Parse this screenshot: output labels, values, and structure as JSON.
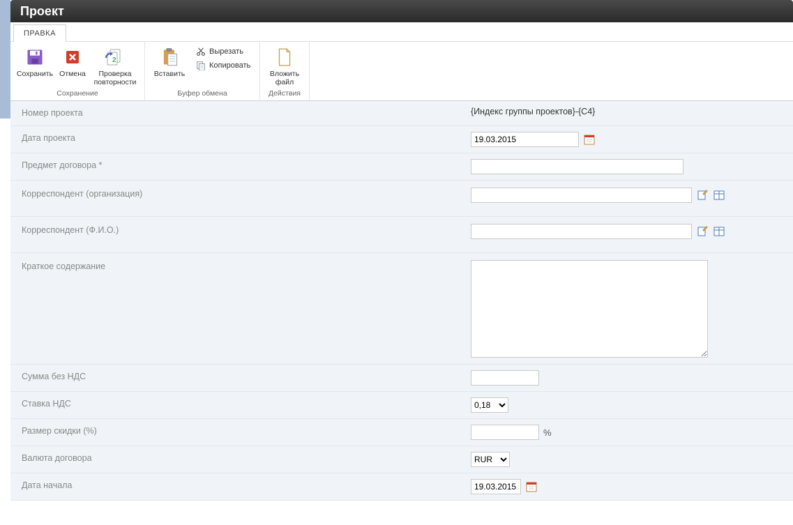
{
  "window": {
    "title": "Проект"
  },
  "tabs": {
    "edit": "ПРАВКА"
  },
  "ribbon": {
    "save": "Сохранить",
    "cancel": "Отмена",
    "check_dup": "Проверка повторности",
    "paste": "Вставить",
    "cut": "Вырезать",
    "copy": "Копировать",
    "attach": "Вложить файл",
    "group_save": "Сохранение",
    "group_clip": "Буфер обмена",
    "group_actions": "Действия"
  },
  "form": {
    "project_number": {
      "label": "Номер проекта",
      "value": "{Индекс группы проектов}-{С4}"
    },
    "project_date": {
      "label": "Дата проекта",
      "value": "19.03.2015"
    },
    "contract_subject": {
      "label": "Предмет договора *",
      "value": ""
    },
    "correspondent_org": {
      "label": "Корреспондент (организация)",
      "value": ""
    },
    "correspondent_fio": {
      "label": "Корреспондент (Ф.И.О.)",
      "value": ""
    },
    "summary": {
      "label": "Краткое содержание",
      "value": ""
    },
    "sum_no_vat": {
      "label": "Сумма без НДС",
      "value": ""
    },
    "vat_rate": {
      "label": "Ставка НДС",
      "value": "0,18"
    },
    "discount": {
      "label": "Размер скидки (%)",
      "value": "",
      "suffix": "%"
    },
    "currency": {
      "label": "Валюта договора",
      "value": "RUR"
    },
    "start_date": {
      "label": "Дата начала",
      "value": "19.03.2015"
    }
  }
}
